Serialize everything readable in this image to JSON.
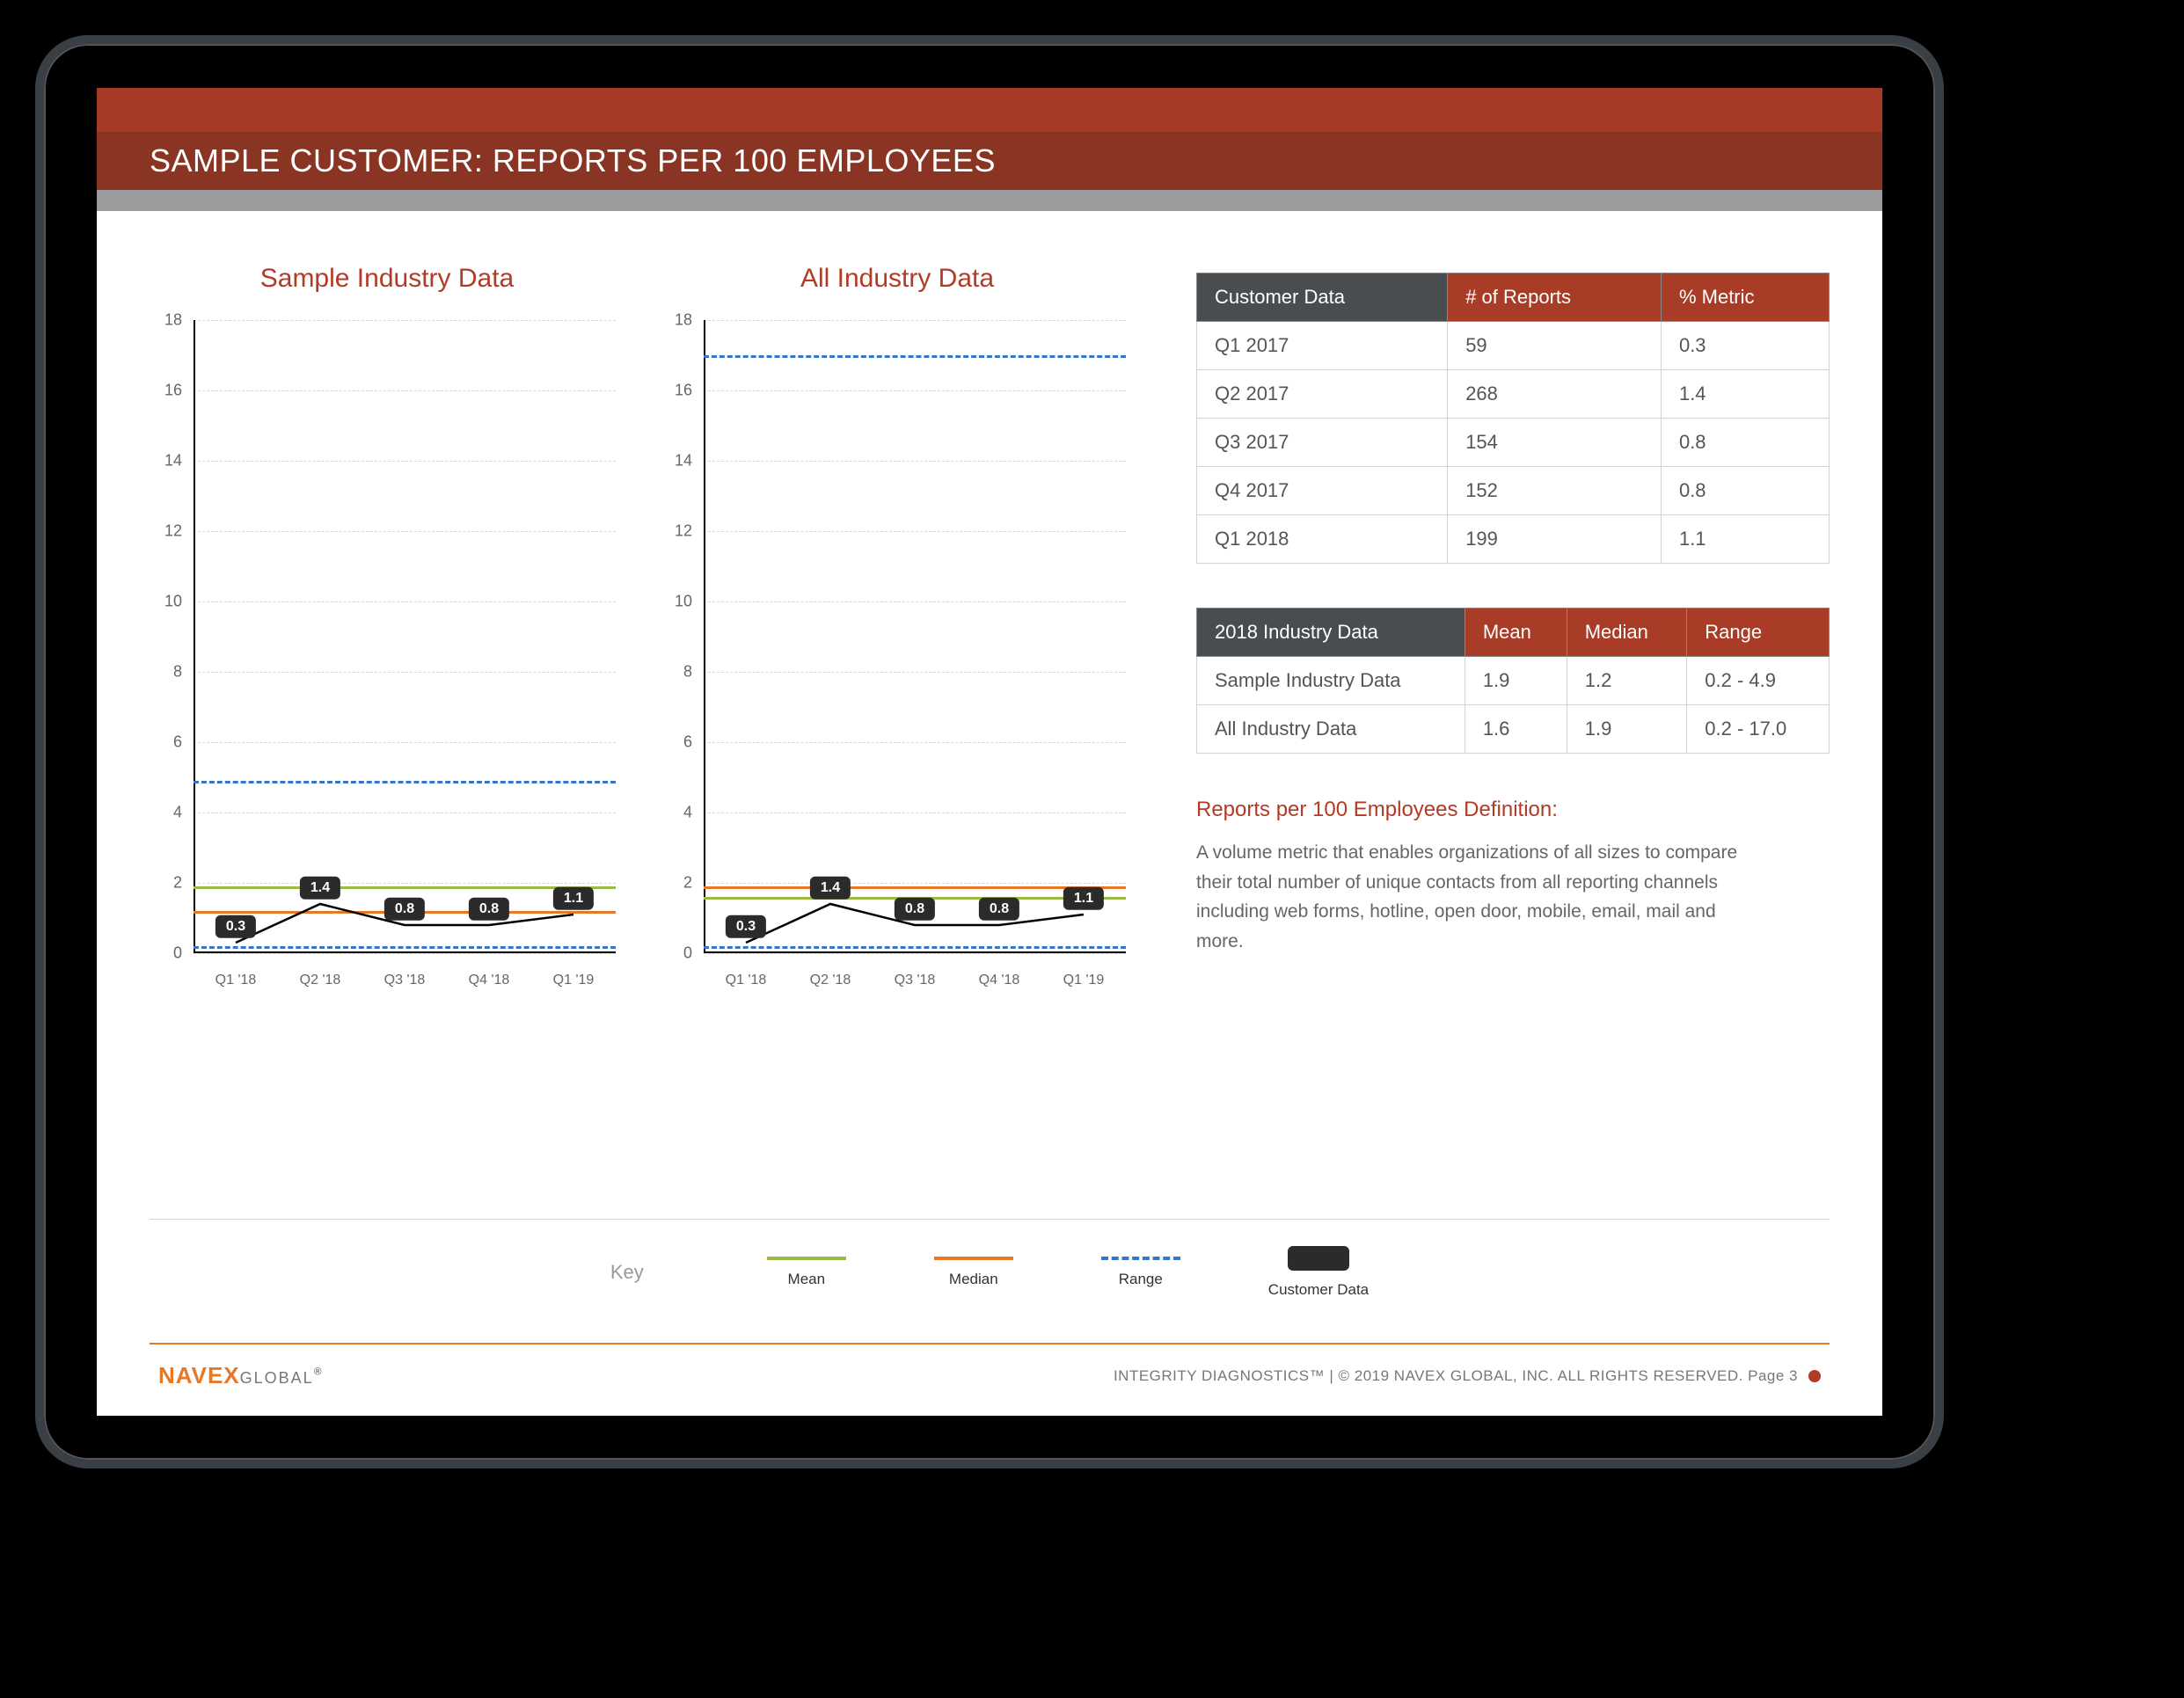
{
  "header": {
    "title": "SAMPLE CUSTOMER: REPORTS PER 100 EMPLOYEES"
  },
  "chart_data": [
    {
      "type": "line",
      "title": "Sample Industry Data",
      "categories": [
        "Q1 '18",
        "Q2 '18",
        "Q3 '18",
        "Q4 '18",
        "Q1 '19"
      ],
      "ylim": [
        0,
        18
      ],
      "yticks": [
        0,
        2,
        4,
        6,
        8,
        10,
        12,
        14,
        16,
        18
      ],
      "series": [
        {
          "name": "Mean",
          "kind": "constant",
          "value": 1.9,
          "style": "solid-green"
        },
        {
          "name": "Median",
          "kind": "constant",
          "value": 1.2,
          "style": "solid-orange"
        },
        {
          "name": "Range-low",
          "kind": "constant",
          "value": 0.2,
          "style": "dashed-blue"
        },
        {
          "name": "Range-high",
          "kind": "constant",
          "value": 4.9,
          "style": "dashed-blue"
        },
        {
          "name": "Customer Data",
          "kind": "line",
          "values": [
            0.3,
            1.4,
            0.8,
            0.8,
            1.1
          ],
          "labels": [
            "0.3",
            "1.4",
            "0.8",
            "0.8",
            "1.1"
          ]
        }
      ]
    },
    {
      "type": "line",
      "title": "All Industry Data",
      "categories": [
        "Q1 '18",
        "Q2 '18",
        "Q3 '18",
        "Q4 '18",
        "Q1 '19"
      ],
      "ylim": [
        0,
        18
      ],
      "yticks": [
        0,
        2,
        4,
        6,
        8,
        10,
        12,
        14,
        16,
        18
      ],
      "series": [
        {
          "name": "Mean",
          "kind": "constant",
          "value": 1.6,
          "style": "solid-green"
        },
        {
          "name": "Median",
          "kind": "constant",
          "value": 1.9,
          "style": "solid-orange"
        },
        {
          "name": "Range-low",
          "kind": "constant",
          "value": 0.2,
          "style": "dashed-blue"
        },
        {
          "name": "Range-high",
          "kind": "constant",
          "value": 17.0,
          "style": "dashed-blue"
        },
        {
          "name": "Customer Data",
          "kind": "line",
          "values": [
            0.3,
            1.4,
            0.8,
            0.8,
            1.1
          ],
          "labels": [
            "0.3",
            "1.4",
            "0.8",
            "0.8",
            "1.1"
          ]
        }
      ]
    }
  ],
  "tables": {
    "customer": {
      "headers": [
        "Customer Data",
        "# of Reports",
        "% Metric"
      ],
      "rows": [
        [
          "Q1 2017",
          "59",
          "0.3"
        ],
        [
          "Q2 2017",
          "268",
          "1.4"
        ],
        [
          "Q3 2017",
          "154",
          "0.8"
        ],
        [
          "Q4 2017",
          "152",
          "0.8"
        ],
        [
          "Q1 2018",
          "199",
          "1.1"
        ]
      ]
    },
    "industry": {
      "headers": [
        "2018 Industry Data",
        "Mean",
        "Median",
        "Range"
      ],
      "rows": [
        [
          "Sample Industry Data",
          "1.9",
          "1.2",
          "0.2 - 4.9"
        ],
        [
          "All Industry Data",
          "1.6",
          "1.9",
          "0.2 - 17.0"
        ]
      ]
    }
  },
  "definition": {
    "heading": "Reports per 100 Employees Definition:",
    "body": "A volume metric that enables organizations of all sizes to compare their total number of unique contacts from all reporting channels including web forms, hotline, open door, mobile, email, mail and more."
  },
  "legend": {
    "label": "Key",
    "items": [
      "Mean",
      "Median",
      "Range",
      "Customer Data"
    ]
  },
  "footer": {
    "brandA": "NAVEX",
    "brandB": "GLOBAL",
    "text": "INTEGRITY DIAGNOSTICS™ | © 2019 NAVEX GLOBAL, INC. ALL RIGHTS RESERVED.  Page 3"
  }
}
